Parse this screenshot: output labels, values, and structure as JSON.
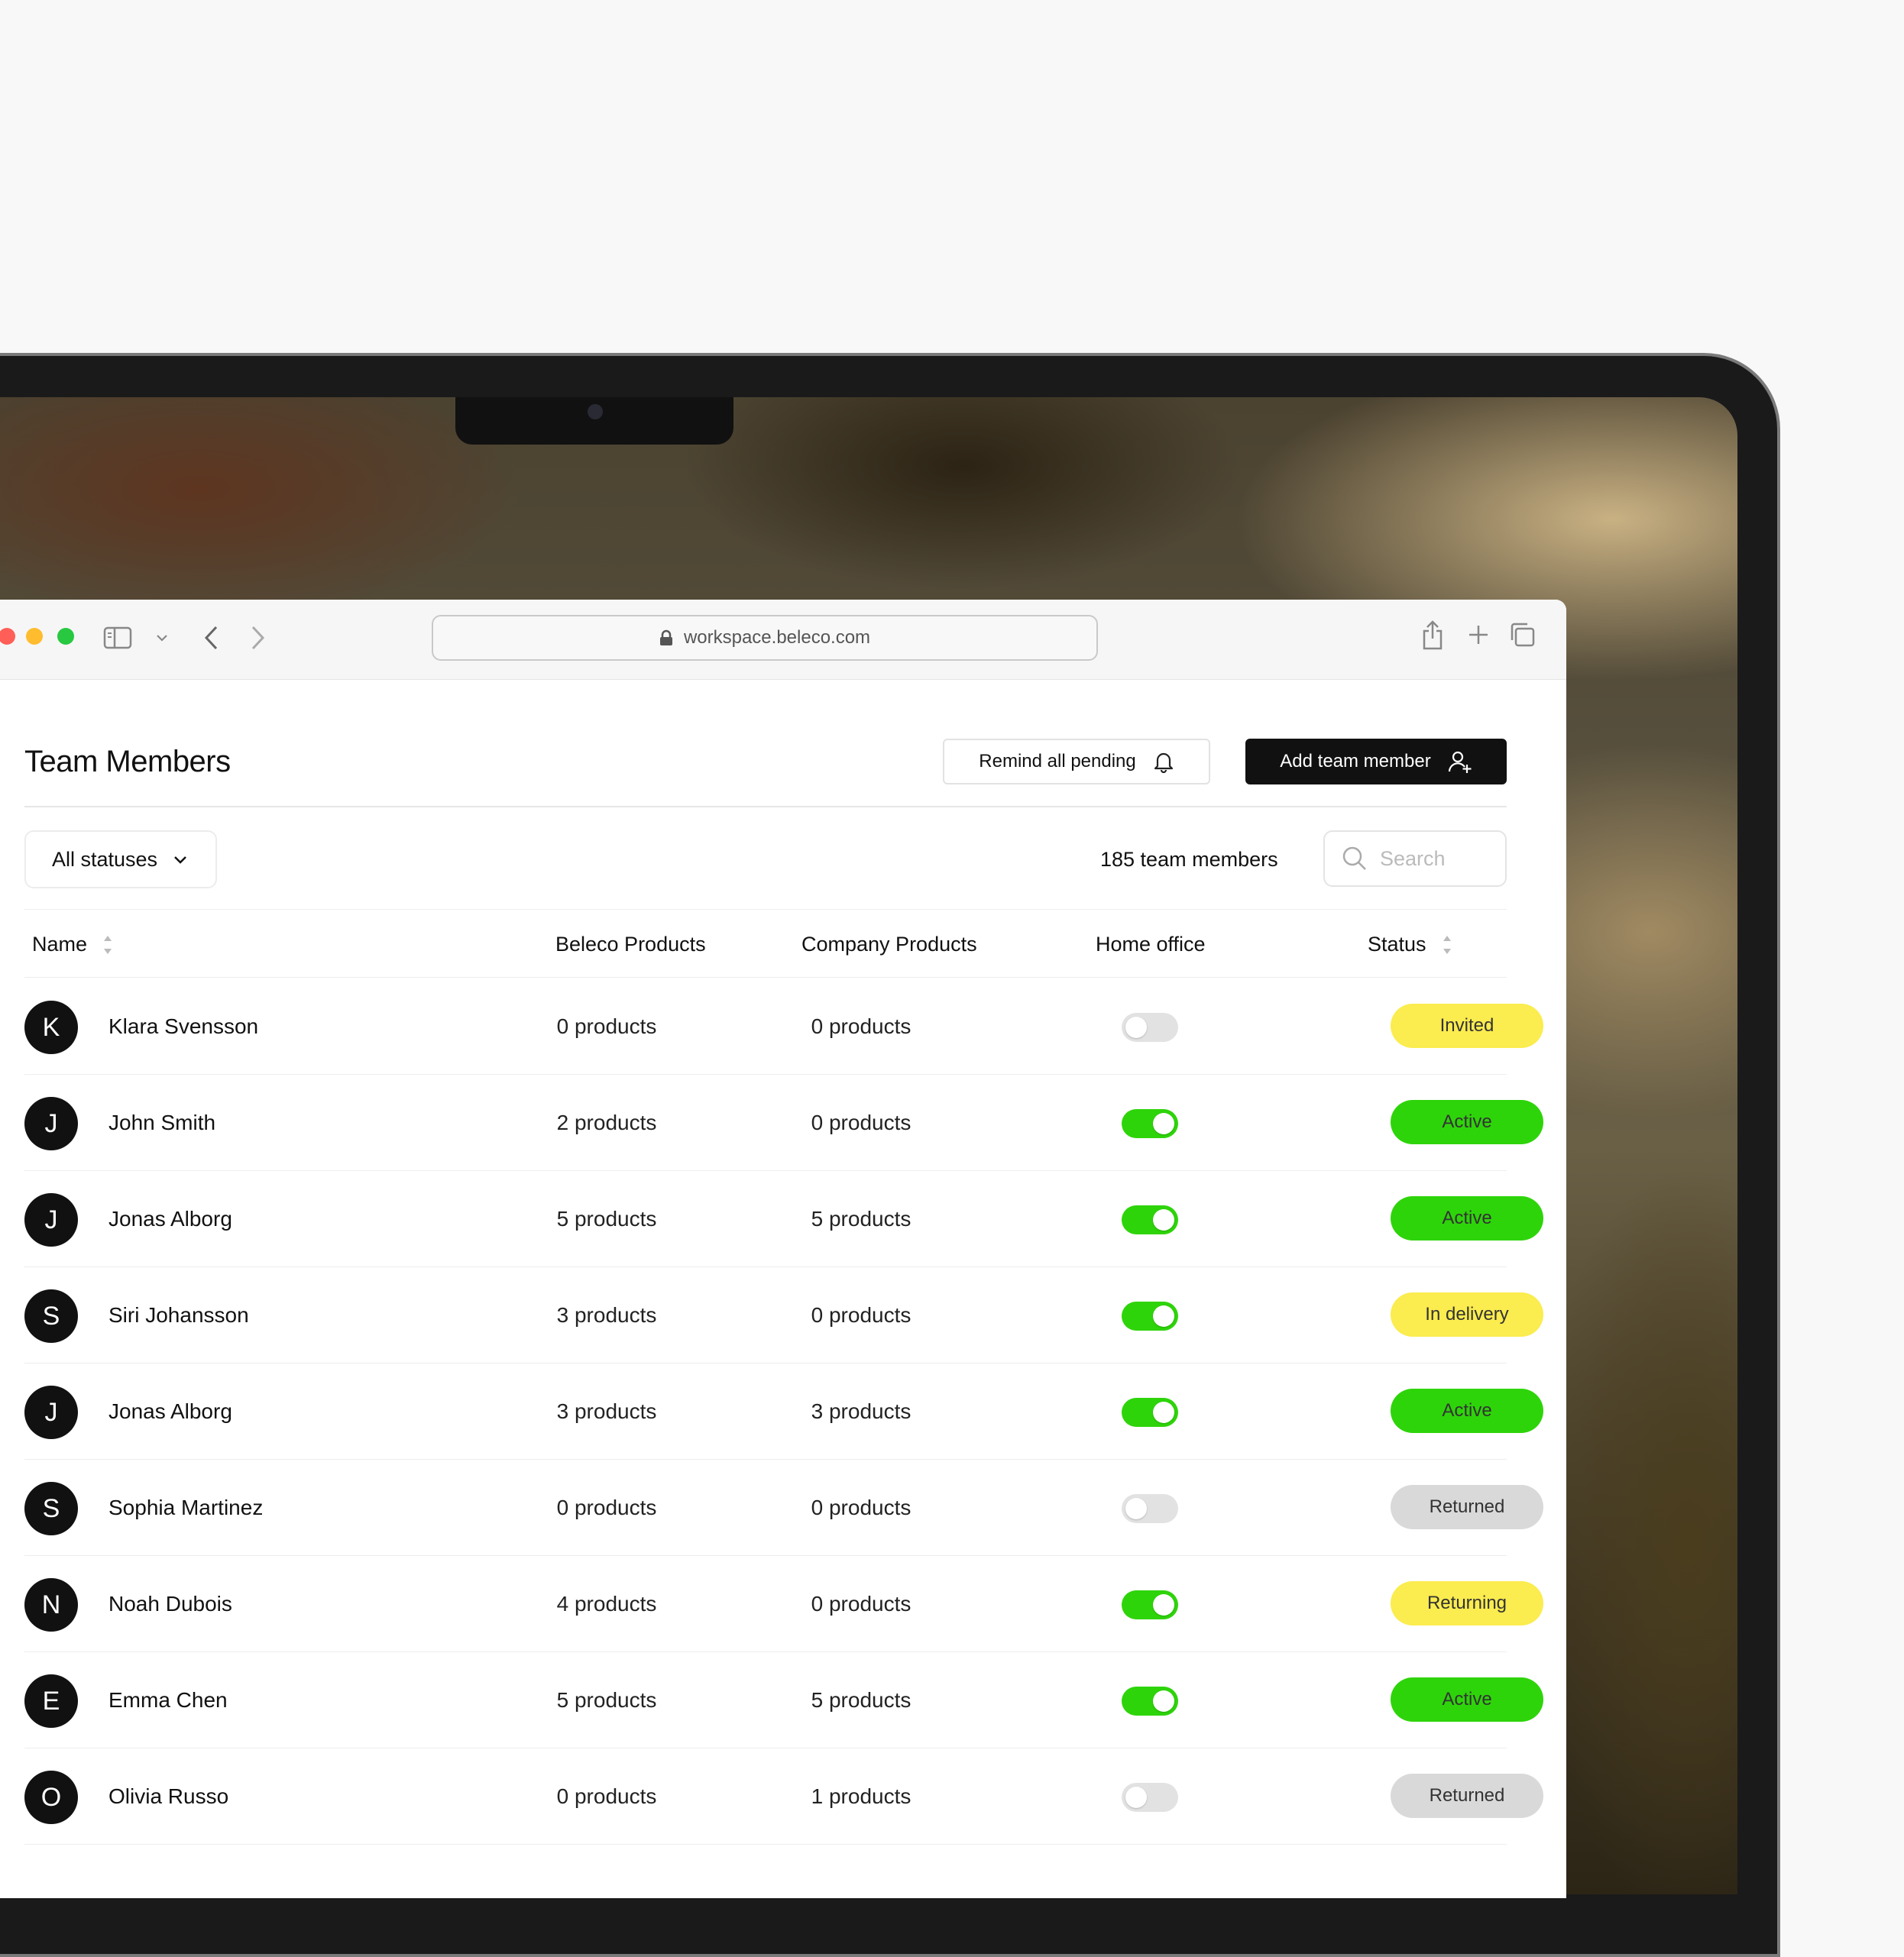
{
  "browser": {
    "url": "workspace.beleco.com"
  },
  "page": {
    "title": "Team Members",
    "remind_label": "Remind all pending",
    "add_label": "Add team member"
  },
  "filters": {
    "status_filter": "All statuses",
    "count_text": "185 team members",
    "search_placeholder": "Search"
  },
  "table": {
    "columns": [
      "Name",
      "Beleco Products",
      "Company Products",
      "Home office",
      "Status"
    ],
    "rows": [
      {
        "initial": "K",
        "name": "Klara Svensson",
        "beleco": "0 products",
        "company": "0 products",
        "home_office": false,
        "status": "Invited"
      },
      {
        "initial": "J",
        "name": "John Smith",
        "beleco": "2 products",
        "company": "0 products",
        "home_office": true,
        "status": "Active"
      },
      {
        "initial": "J",
        "name": "Jonas Alborg",
        "beleco": "5 products",
        "company": "5 products",
        "home_office": true,
        "status": "Active"
      },
      {
        "initial": "S",
        "name": "Siri Johansson",
        "beleco": "3 products",
        "company": "0 products",
        "home_office": true,
        "status": "In delivery"
      },
      {
        "initial": "J",
        "name": "Jonas Alborg",
        "beleco": "3 products",
        "company": "3 products",
        "home_office": true,
        "status": "Active"
      },
      {
        "initial": "S",
        "name": "Sophia Martinez",
        "beleco": "0 products",
        "company": "0 products",
        "home_office": false,
        "status": "Returned"
      },
      {
        "initial": "N",
        "name": "Noah Dubois",
        "beleco": "4 products",
        "company": "0 products",
        "home_office": true,
        "status": "Returning"
      },
      {
        "initial": "E",
        "name": "Emma Chen",
        "beleco": "5 products",
        "company": "5 products",
        "home_office": true,
        "status": "Active"
      },
      {
        "initial": "O",
        "name": "Olivia Russo",
        "beleco": "0 products",
        "company": "1 products",
        "home_office": false,
        "status": "Returned"
      }
    ]
  },
  "colors": {
    "active": "#2ed40a",
    "pending": "#fbec4f",
    "returned": "#d9d9d9",
    "dark": "#111111"
  },
  "icons": {
    "lock": "lock-icon",
    "bell": "bell-icon",
    "add_user": "add-user-icon",
    "chevron": "chevron-down-icon",
    "search": "search-icon",
    "sort": "sort-icon"
  }
}
